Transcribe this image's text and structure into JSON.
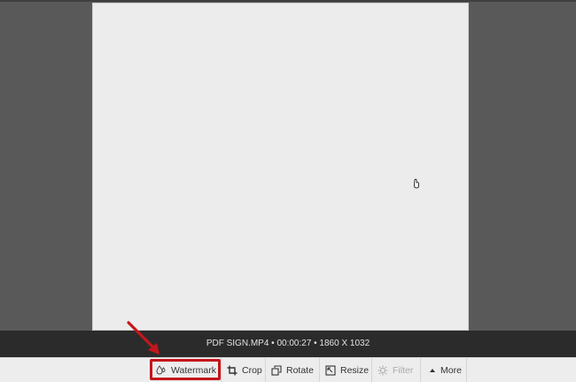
{
  "preview": {
    "info": "PDF SIGN.MP4 • 00:00:27 • 1860 X 1032"
  },
  "toolbar": {
    "watermark_label": "Watermark",
    "crop_label": "Crop",
    "rotate_label": "Rotate",
    "resize_label": "Resize",
    "filter_label": "Filter",
    "more_label": "More"
  },
  "colors": {
    "annotation": "#c4161c",
    "background": "#595959",
    "canvas": "#ececec",
    "info_bar": "#2b2b2b",
    "toolbar": "#ededed"
  },
  "icons": {
    "watermark": "droplet-icon",
    "crop": "crop-icon",
    "rotate": "rotate-icon",
    "resize": "resize-icon",
    "filter": "filter-icon",
    "more": "caret-up-icon"
  }
}
